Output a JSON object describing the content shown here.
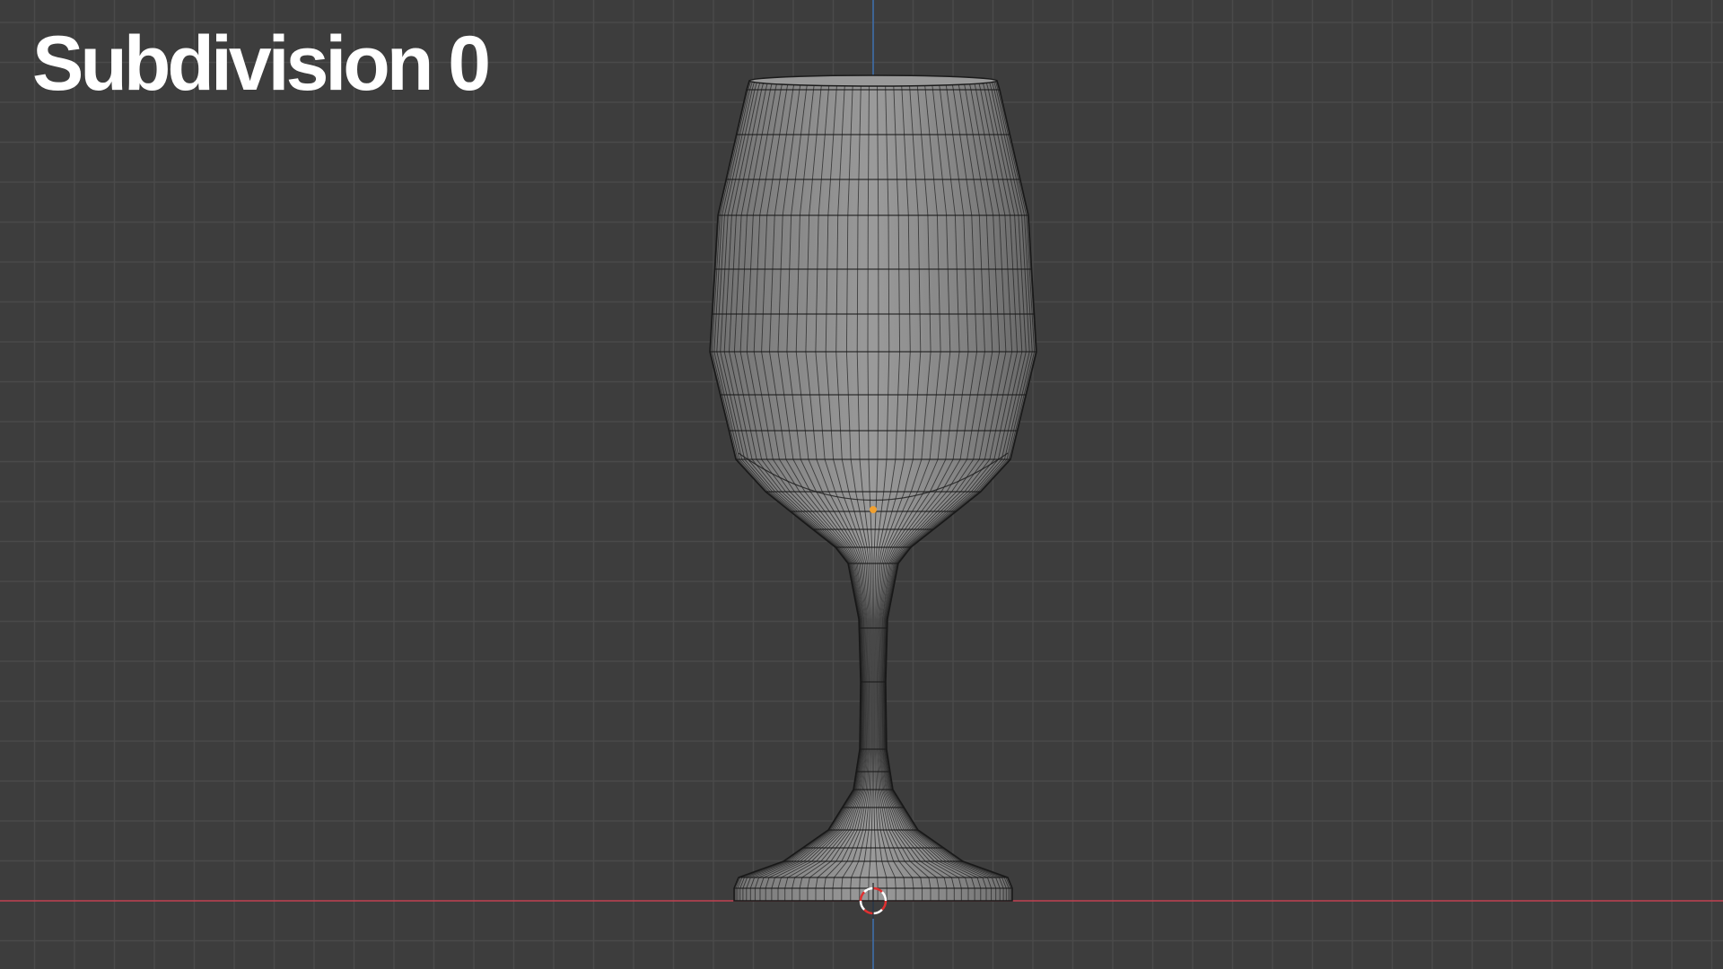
{
  "viewport": {
    "overlay_label": "Subdivision 0",
    "colors": {
      "background": "#3d3d3d",
      "grid_minor": "#4a4a4a",
      "grid_major": "#545454",
      "axis_x": "#c0404f",
      "axis_z": "#3c6fb0",
      "mesh_face": "#8a8a8a",
      "mesh_wire": "#1a1a1a",
      "origin_point": "#f0a030",
      "cursor_red": "#e03030",
      "cursor_white": "#ffffff"
    },
    "icons": {
      "origin": "object-origin-dot-icon",
      "cursor": "3d-cursor-icon"
    }
  }
}
